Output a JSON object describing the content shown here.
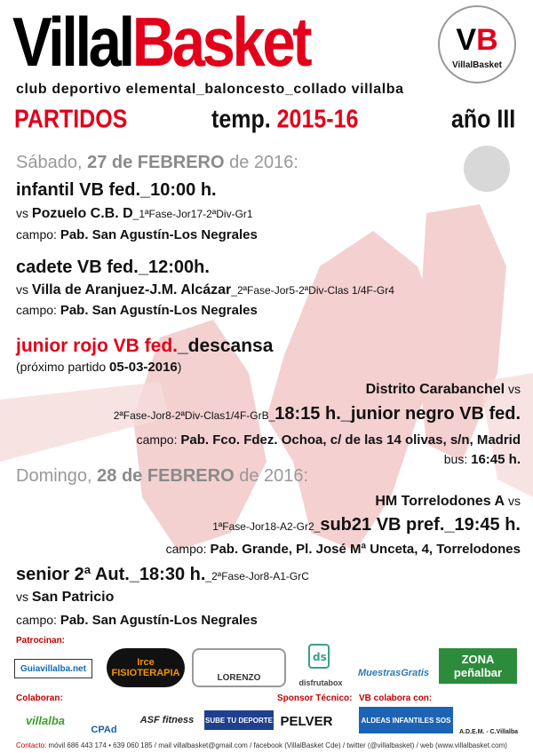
{
  "header": {
    "title_part1": "Villal",
    "title_part2": "Basket",
    "logo_letters_1": "V",
    "logo_letters_2": "B",
    "logo_text": "VillalBasket",
    "subtitle": "club deportivo elemental_baloncesto_collado villalba",
    "partidos": "PARTIDOS",
    "temp_label": "temp.",
    "temp_value": "2015-16",
    "anio": "año III"
  },
  "saturday": {
    "day_pre": "Sábado, ",
    "day_bold": "27 de FEBRERO",
    "day_post": " de 2016:"
  },
  "matches": {
    "infantil": {
      "title": "infantil VB fed._10:00 h.",
      "vs": "vs ",
      "rival": "Pozuelo C.B. D",
      "phase": "_1ªFase-Jor17-2ªDiv-Gr1",
      "campo_label": "campo: ",
      "campo": "Pab. San Agustín-Los Negrales"
    },
    "cadete": {
      "title": "cadete VB fed._12:00h.",
      "vs": "vs ",
      "rival": "Villa de Aranjuez-J.M. Alcázar",
      "phase": "_2ªFase-Jor5-2ªDiv-Clas 1/4F-Gr4",
      "campo_label": "campo: ",
      "campo": "Pab. San Agustín-Los Negrales"
    },
    "junior_rojo": {
      "title_red": "junior rojo VB fed.",
      "title_black": "_descansa",
      "next_pre": "(próximo partido ",
      "next_date": "05-03-2016",
      "next_post": ")"
    },
    "junior_negro": {
      "rival": "Distrito Carabanchel",
      "vs": " vs",
      "phase": "2ªFase-Jor8-2ªDiv-Clas1/4F-GrB_",
      "title": "18:15 h._junior negro VB fed.",
      "campo_label": "campo: ",
      "campo": "Pab. Fco. Fdez. Ochoa, c/ de las 14 olivas, s/n, Madrid",
      "bus_label": "bus: ",
      "bus": "16:45 h."
    },
    "sub21": {
      "rival": "HM Torrelodones A",
      "vs": " vs",
      "phase": "1ªFase-Jor18-A2-Gr2_",
      "title": "sub21 VB pref._19:45 h.",
      "campo_label": "campo: ",
      "campo": "Pab. Grande, Pl. José Mª Unceta, 4, Torrelodones"
    },
    "senior": {
      "title": "senior 2ª Aut._18:30 h.",
      "phase": "_2ªFase-Jor8-A1-GrC",
      "vs": "vs ",
      "rival": "San Patricio",
      "campo_label": "campo: ",
      "campo": "Pab. San Agustín-Los Negrales"
    }
  },
  "sunday": {
    "day_pre": "Domingo, ",
    "day_bold": "28 de FEBRERO",
    "day_post": " de 2016:"
  },
  "sponsors": {
    "patrocinan_label": "Patrocinan:",
    "colaboran_label": "Colaboran:",
    "sponsor_tecnico_label": "Sponsor Técnico:",
    "vb_colabora_label": "VB colabora con:",
    "row1": [
      "Guiavillalba.net",
      "Irce FISIOTERAPIA",
      "LORENZO",
      "disfrutabox",
      "MuestrasGratis",
      "ZONA peñalbar"
    ],
    "row2": [
      "villalba",
      "CPAd",
      "ASF fitness",
      "SUBE TU DEPORTE",
      "PELVER",
      "ALDEAS INFANTILES SOS",
      "A.D.E.M. - C.Villalba"
    ]
  },
  "footer": {
    "label": "Contacto:",
    "text": " móvil 686 443 174 • 639 060 185 / mail villalbasket@gmail.com / facebook (VillalBasket Cde) / twitter (@villalbasket) / web (www.villalbasket.com)"
  },
  "colors": {
    "brand_red": "#e2001a",
    "silhouette": "#f2c9c9"
  }
}
